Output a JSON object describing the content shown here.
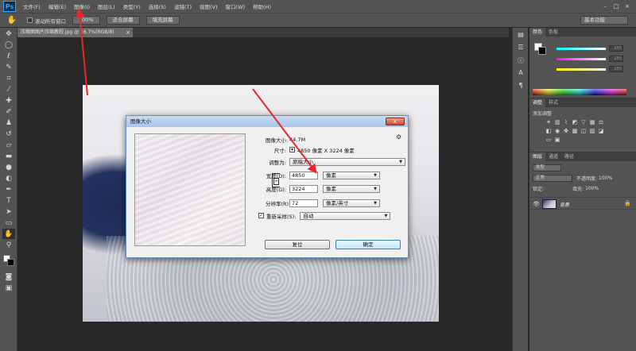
{
  "app": {
    "logo": "Ps",
    "menu": [
      "文件(F)",
      "编辑(E)",
      "图像(I)",
      "图层(L)",
      "类型(Y)",
      "选择(S)",
      "滤镜(T)",
      "视图(V)",
      "窗口(W)",
      "帮助(H)"
    ],
    "window_controls": [
      "–",
      "□",
      "×"
    ]
  },
  "options_bar": {
    "tool_icon": "hand-icon",
    "scroll_all_label": "滚动所有窗口",
    "buttons": [
      "100%",
      "适合屏幕",
      "填充屏幕"
    ],
    "workspace": "基本功能"
  },
  "document": {
    "tab_title": "压缩图图片压缩教程.jpg @ 16.7%(RGB/8)",
    "close": "×"
  },
  "dialog": {
    "title": "图像大小",
    "close": "x",
    "image_size_label": "图像大小:",
    "image_size_value": "44.7M",
    "dimensions_label": "尺寸:",
    "dimensions_value": "4850 像素  X  3224 像素",
    "fit_label": "调整为:",
    "fit_value": "原稿大小",
    "width_label": "宽度(D):",
    "width_value": "4850",
    "width_unit": "像素",
    "height_label": "高度(G):",
    "height_value": "3224",
    "height_unit": "像素",
    "resolution_label": "分辨率(R):",
    "resolution_value": "72",
    "resolution_unit": "像素/英寸",
    "resample_label": "重新采样(S):",
    "resample_value": "自动",
    "resample_checked": true,
    "reset_button": "复位",
    "ok_button": "确定"
  },
  "panels": {
    "color_tabs": [
      "颜色",
      "色板"
    ],
    "color_values": [
      "255",
      "255",
      "255"
    ],
    "adjust_tabs": [
      "调整",
      "样式"
    ],
    "adjust_label": "添加调整",
    "layers_tabs": [
      "图层",
      "通道",
      "路径"
    ],
    "filter_kind": "类型",
    "blend_mode": "正常",
    "opacity_label": "不透明度:",
    "opacity_value": "100%",
    "lock_label": "锁定:",
    "fill_label": "填充:",
    "fill_value": "100%",
    "layer_name": "背景"
  }
}
